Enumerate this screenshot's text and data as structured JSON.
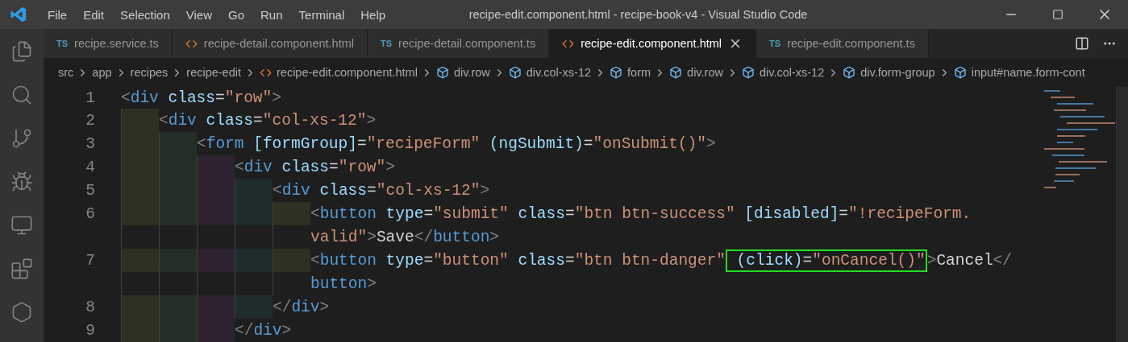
{
  "menu": [
    "File",
    "Edit",
    "Selection",
    "View",
    "Go",
    "Run",
    "Terminal",
    "Help"
  ],
  "window": {
    "title": "recipe-edit.component.html - recipe-book-v4 - Visual Studio Code"
  },
  "tabs": [
    {
      "label": "recipe.service.ts",
      "kind": "ts",
      "badge": "TS",
      "selected": false
    },
    {
      "label": "recipe-detail.component.html",
      "kind": "html",
      "selected": false
    },
    {
      "label": "recipe-detail.component.ts",
      "kind": "ts",
      "badge": "TS",
      "selected": false
    },
    {
      "label": "recipe-edit.component.html",
      "kind": "html",
      "selected": true
    },
    {
      "label": "recipe-edit.component.ts",
      "kind": "ts",
      "badge": "TS",
      "selected": false
    }
  ],
  "breadcrumbs": [
    {
      "label": "src",
      "kind": "folder"
    },
    {
      "label": "app",
      "kind": "folder"
    },
    {
      "label": "recipes",
      "kind": "folder"
    },
    {
      "label": "recipe-edit",
      "kind": "folder"
    },
    {
      "label": "recipe-edit.component.html",
      "kind": "file"
    },
    {
      "label": "div.row",
      "kind": "symbol"
    },
    {
      "label": "div.col-xs-12",
      "kind": "symbol"
    },
    {
      "label": "form",
      "kind": "symbol"
    },
    {
      "label": "div.row",
      "kind": "symbol"
    },
    {
      "label": "div.col-xs-12",
      "kind": "symbol"
    },
    {
      "label": "div.form-group",
      "kind": "symbol"
    },
    {
      "label": "input#name.form-cont",
      "kind": "symbol"
    }
  ],
  "code": [
    {
      "number": "1",
      "segments": [
        {
          "tokens": [
            {
              "kind": "punct",
              "text": "<"
            },
            {
              "kind": "tag",
              "text": "div"
            },
            {
              "kind": "attr",
              "text": " class"
            },
            {
              "kind": "plain",
              "text": "="
            },
            {
              "kind": "string",
              "text": "\"row\""
            },
            {
              "kind": "punct",
              "text": ">"
            }
          ]
        }
      ],
      "children": [
        {
          "number": "2",
          "segments": [
            {
              "tokens": [
                {
                  "kind": "punct",
                  "text": "<"
                },
                {
                  "kind": "tag",
                  "text": "div"
                },
                {
                  "kind": "attr",
                  "text": " class"
                },
                {
                  "kind": "plain",
                  "text": "="
                },
                {
                  "kind": "string",
                  "text": "\"col-xs-12\""
                },
                {
                  "kind": "punct",
                  "text": ">"
                }
              ]
            }
          ],
          "children": [
            {
              "number": "3",
              "segments": [
                {
                  "tokens": [
                    {
                      "kind": "punct",
                      "text": "<"
                    },
                    {
                      "kind": "tag",
                      "text": "form"
                    },
                    {
                      "kind": "attr",
                      "text": " [formGroup]"
                    },
                    {
                      "kind": "plain",
                      "text": "="
                    },
                    {
                      "kind": "string",
                      "text": "\"recipeForm\""
                    },
                    {
                      "kind": "attr",
                      "text": " (ngSubmit)"
                    },
                    {
                      "kind": "plain",
                      "text": "="
                    },
                    {
                      "kind": "string",
                      "text": "\"onSubmit()\""
                    },
                    {
                      "kind": "punct",
                      "text": ">"
                    }
                  ]
                }
              ],
              "children": [
                {
                  "number": "4",
                  "segments": [
                    {
                      "tokens": [
                        {
                          "kind": "punct",
                          "text": "<"
                        },
                        {
                          "kind": "tag",
                          "text": "div"
                        },
                        {
                          "kind": "attr",
                          "text": " class"
                        },
                        {
                          "kind": "plain",
                          "text": "="
                        },
                        {
                          "kind": "string",
                          "text": "\"row\""
                        },
                        {
                          "kind": "punct",
                          "text": ">"
                        }
                      ]
                    }
                  ],
                  "children": [
                    {
                      "number": "5",
                      "segments": [
                        {
                          "tokens": [
                            {
                              "kind": "punct",
                              "text": "<"
                            },
                            {
                              "kind": "tag",
                              "text": "div"
                            },
                            {
                              "kind": "attr",
                              "text": " class"
                            },
                            {
                              "kind": "plain",
                              "text": "="
                            },
                            {
                              "kind": "string",
                              "text": "\"col-xs-12\""
                            },
                            {
                              "kind": "punct",
                              "text": ">"
                            }
                          ]
                        }
                      ],
                      "children": [
                        {
                          "number": "6",
                          "segments": [
                            {
                              "tokens": [
                                {
                                  "kind": "punct",
                                  "text": "<"
                                },
                                {
                                  "kind": "tag",
                                  "text": "button"
                                },
                                {
                                  "kind": "attr",
                                  "text": " type"
                                },
                                {
                                  "kind": "plain",
                                  "text": "="
                                },
                                {
                                  "kind": "string",
                                  "text": "\"submit\""
                                },
                                {
                                  "kind": "attr",
                                  "text": " class"
                                },
                                {
                                  "kind": "plain",
                                  "text": "="
                                },
                                {
                                  "kind": "string",
                                  "text": "\"btn btn-success\""
                                },
                                {
                                  "kind": "attr",
                                  "text": " [disabled]"
                                },
                                {
                                  "kind": "plain",
                                  "text": "="
                                },
                                {
                                  "kind": "string",
                                  "text": "\"!recipeForm."
                                }
                              ]
                            },
                            {
                              "tokens": [
                                {
                                  "kind": "string",
                                  "text": "valid\""
                                },
                                {
                                  "kind": "punct",
                                  "text": ">"
                                },
                                {
                                  "kind": "plain",
                                  "text": "Save"
                                },
                                {
                                  "kind": "punct",
                                  "text": "</"
                                },
                                {
                                  "kind": "tag",
                                  "text": "button"
                                },
                                {
                                  "kind": "punct",
                                  "text": ">"
                                }
                              ]
                            }
                          ]
                        },
                        {
                          "number": "7",
                          "segments": [
                            {
                              "tokens": [
                                {
                                  "kind": "punct",
                                  "text": "<"
                                },
                                {
                                  "kind": "tag",
                                  "text": "button"
                                },
                                {
                                  "kind": "attr",
                                  "text": " type"
                                },
                                {
                                  "kind": "plain",
                                  "text": "="
                                },
                                {
                                  "kind": "string",
                                  "text": "\"button\""
                                },
                                {
                                  "kind": "attr",
                                  "text": " class"
                                },
                                {
                                  "kind": "plain",
                                  "text": "="
                                },
                                {
                                  "kind": "string",
                                  "text": "\"btn btn-danger\""
                                },
                                {
                                  "kind": "box",
                                  "tokens": [
                                    {
                                      "kind": "attr",
                                      "text": " (click)"
                                    },
                                    {
                                      "kind": "plain",
                                      "text": "="
                                    },
                                    {
                                      "kind": "string",
                                      "text": "\"onCancel()\""
                                    }
                                  ]
                                },
                                {
                                  "kind": "punct",
                                  "text": ">"
                                },
                                {
                                  "kind": "plain",
                                  "text": "Cancel"
                                },
                                {
                                  "kind": "punct",
                                  "text": "</"
                                }
                              ]
                            },
                            {
                              "tokens": [
                                {
                                  "kind": "tag",
                                  "text": "button"
                                },
                                {
                                  "kind": "punct",
                                  "text": ">"
                                }
                              ]
                            }
                          ]
                        }
                      ]
                    },
                    {
                      "number": "8",
                      "segments": [
                        {
                          "tokens": [
                            {
                              "kind": "punct",
                              "text": "</"
                            },
                            {
                              "kind": "tag",
                              "text": "div"
                            },
                            {
                              "kind": "punct",
                              "text": ">"
                            }
                          ]
                        }
                      ]
                    }
                  ]
                },
                {
                  "number": "9",
                  "segments": [
                    {
                      "tokens": [
                        {
                          "kind": "punct",
                          "text": "</"
                        },
                        {
                          "kind": "tag",
                          "text": "div"
                        },
                        {
                          "kind": "punct",
                          "text": ">"
                        }
                      ]
                    }
                  ]
                }
              ]
            }
          ]
        }
      ]
    }
  ]
}
